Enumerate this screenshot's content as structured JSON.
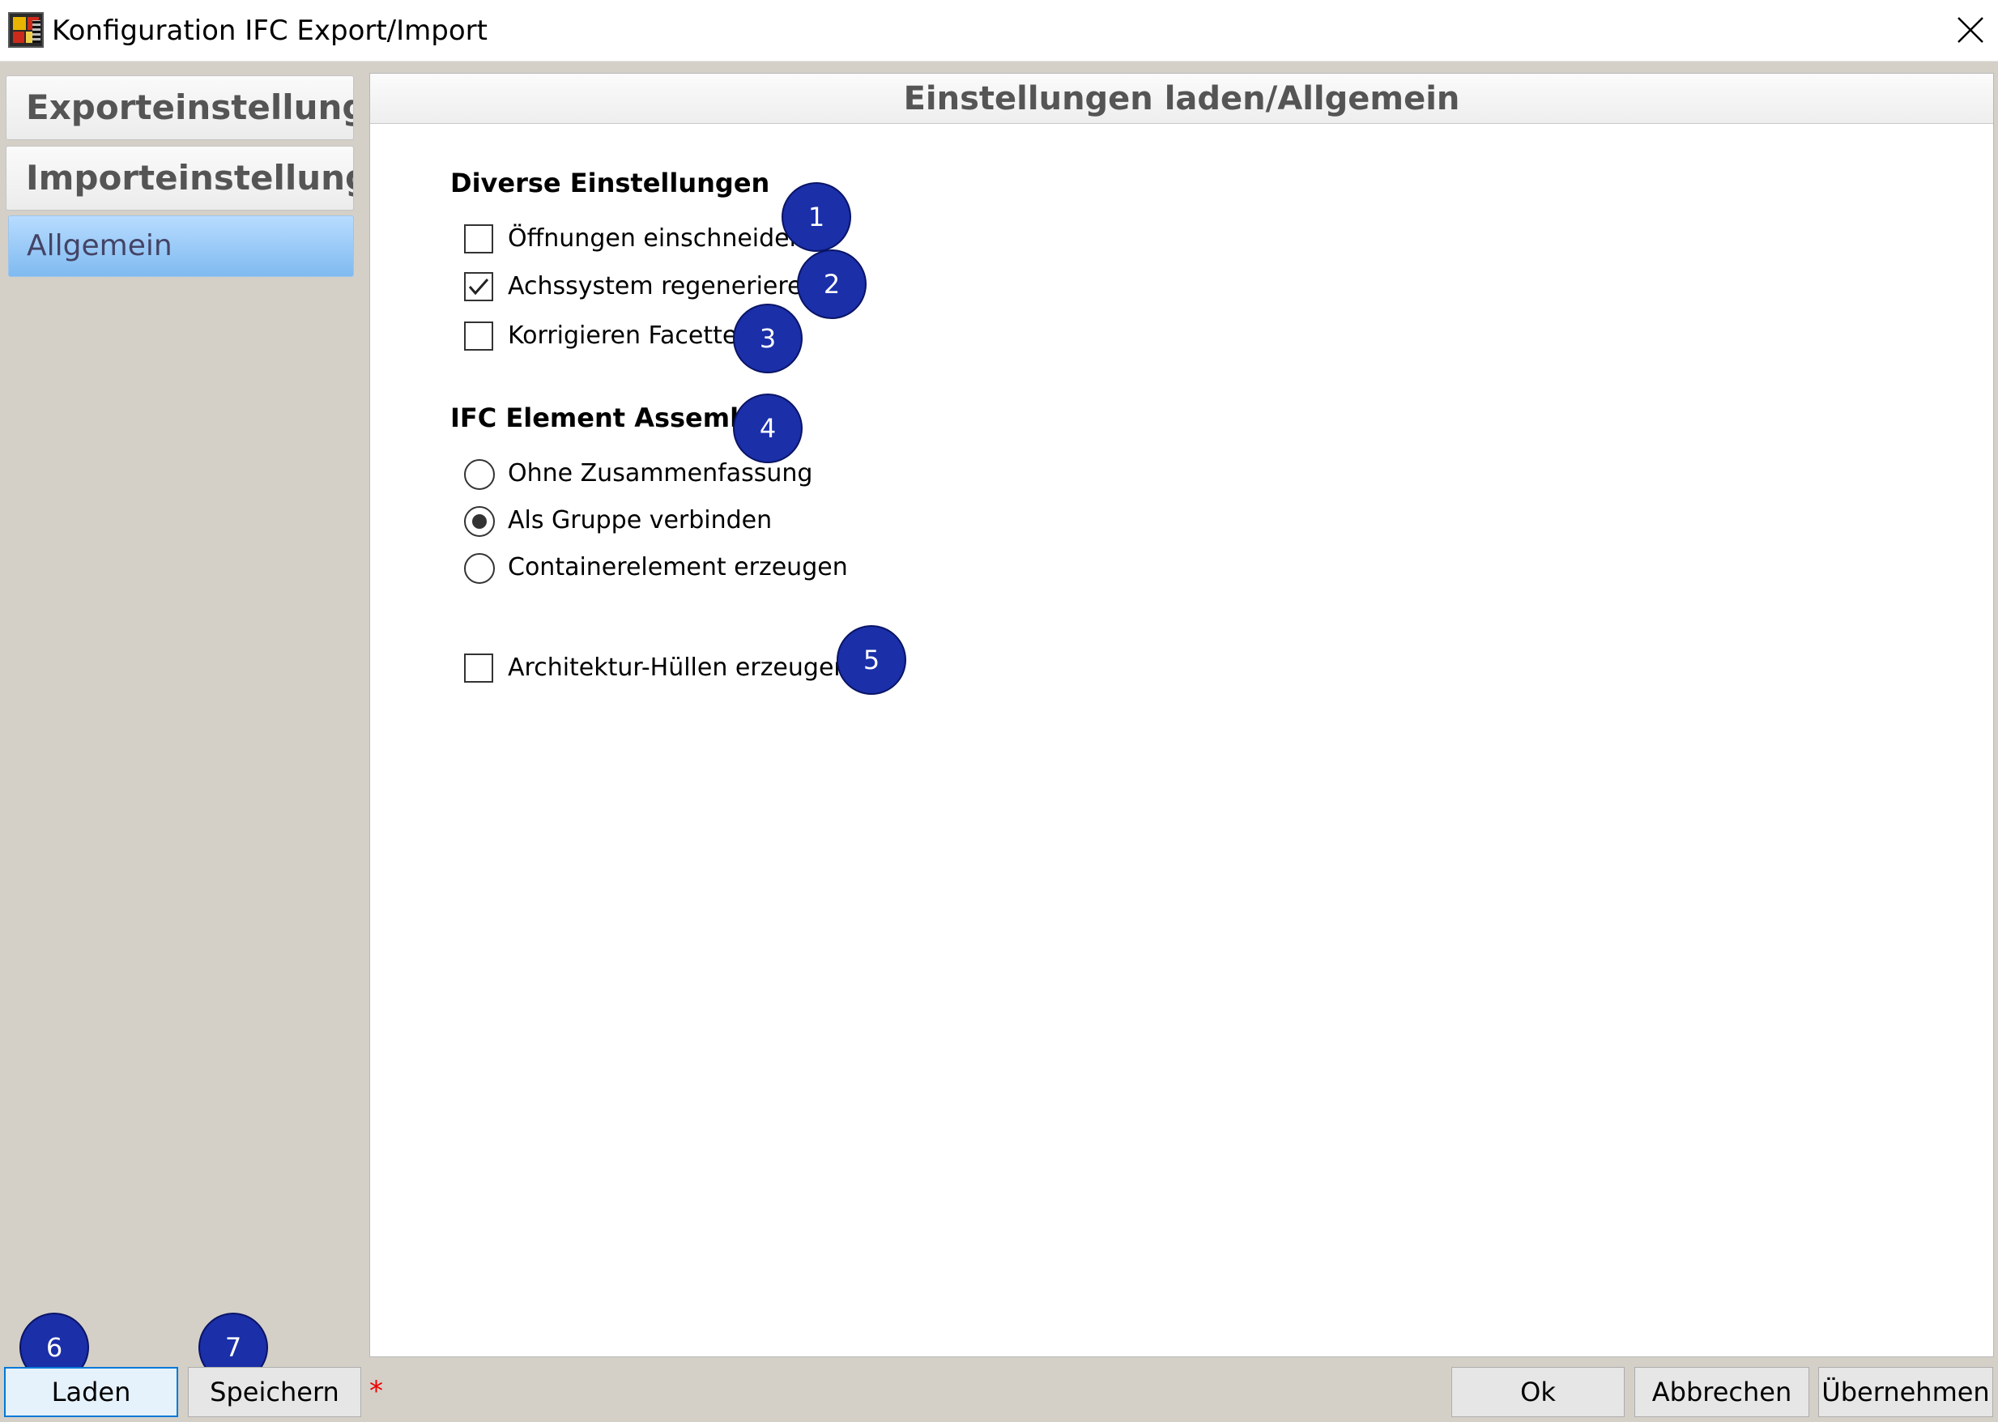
{
  "window": {
    "title": "Konfiguration IFC Export/Import",
    "close_label": "Schließen"
  },
  "sidebar": {
    "tabs": [
      {
        "label": "Exporteinstellungen"
      },
      {
        "label": "Importeinstellungen"
      }
    ],
    "items": [
      {
        "label": "Allgemein",
        "selected": true
      }
    ]
  },
  "panel": {
    "title": "Einstellungen laden/Allgemein",
    "diverse": {
      "heading": "Diverse Einstellungen",
      "options": [
        {
          "label": "Öffnungen einschneiden",
          "checked": false
        },
        {
          "label": "Achssystem regenerieren",
          "checked": true
        },
        {
          "label": "Korrigieren Facetten",
          "checked": false
        }
      ]
    },
    "assembly": {
      "heading": "IFC Element Assembly",
      "options": [
        {
          "label": "Ohne Zusammenfassung",
          "selected": false
        },
        {
          "label": "Als Gruppe verbinden",
          "selected": true
        },
        {
          "label": "Containerelement erzeugen",
          "selected": false
        }
      ]
    },
    "architektur": {
      "label": "Architektur-Hüllen erzeugen",
      "checked": false
    }
  },
  "callouts": [
    "1",
    "2",
    "3",
    "4",
    "5",
    "6",
    "7"
  ],
  "footer": {
    "load_label": "Laden",
    "save_label": "Speichern",
    "modified_marker": "*",
    "ok_label": "Ok",
    "cancel_label": "Abbrechen",
    "apply_label": "Übernehmen"
  },
  "colors": {
    "callout": "#1a2fa8",
    "selected_item": "#7fbaf0",
    "modified_marker": "#e00000"
  }
}
